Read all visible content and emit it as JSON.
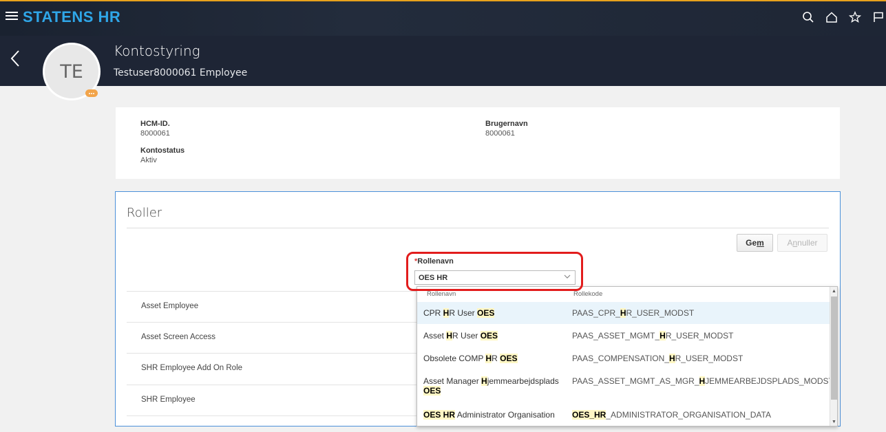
{
  "app": {
    "brand": "STATENS HR"
  },
  "header": {
    "title": "Kontostyring",
    "subtitle": "Testuser8000061 Employee",
    "avatar_initials": "TE"
  },
  "info": {
    "hcm_label": "HCM-ID.",
    "hcm_value": "8000061",
    "username_label": "Brugernavn",
    "username_value": "8000061",
    "status_label": "Kontostatus",
    "status_value": "Aktiv"
  },
  "roles": {
    "title": "Roller",
    "save_pre": "Ge",
    "save_u": "m",
    "cancel_pre": "A",
    "cancel_u": "n",
    "cancel_post": "nuller",
    "field_required": "*",
    "field_label": "Rollenavn",
    "field_value": "OES HR",
    "rows": [
      "Asset Employee",
      "Asset Screen Access",
      "SHR Employee Add On Role",
      "SHR Employee"
    ]
  },
  "dropdown": {
    "col1": "Rollenavn",
    "col2": "Rollekode",
    "options": [
      {
        "name_parts": [
          "CPR ",
          "H",
          "R User ",
          "OES"
        ],
        "code_parts": [
          "PAAS_CPR_",
          "H",
          "R_USER_MODST"
        ]
      },
      {
        "name_parts": [
          "Asset ",
          "H",
          "R User ",
          "OES"
        ],
        "code_parts": [
          "PAAS_ASSET_MGMT_",
          "H",
          "R_USER_MODST"
        ]
      },
      {
        "name_parts": [
          "Obsolete COMP ",
          "H",
          "R ",
          "OES"
        ],
        "code_parts": [
          "PAAS_COMPENSATION_",
          "H",
          "R_USER_MODST"
        ]
      },
      {
        "name_parts": [
          "Asset Manager ",
          "H",
          "jemmearbejdsplads ",
          "OES"
        ],
        "code_parts": [
          "PAAS_ASSET_MGMT_AS_MGR_",
          "H",
          "JEMMEARBEJDSPLADS_MODST"
        ]
      },
      {
        "name_parts": [
          "",
          "OES HR",
          " Administrator Organisation",
          ""
        ],
        "code_parts": [
          "",
          "OES_HR",
          "_ADMINISTRATOR_ORGANISATION_DATA"
        ]
      }
    ]
  },
  "colors": {
    "brand": "#2fa6e8",
    "header_bg": "#1e2535",
    "highlight": "#e21c1c",
    "accent": "#e8a21c"
  }
}
